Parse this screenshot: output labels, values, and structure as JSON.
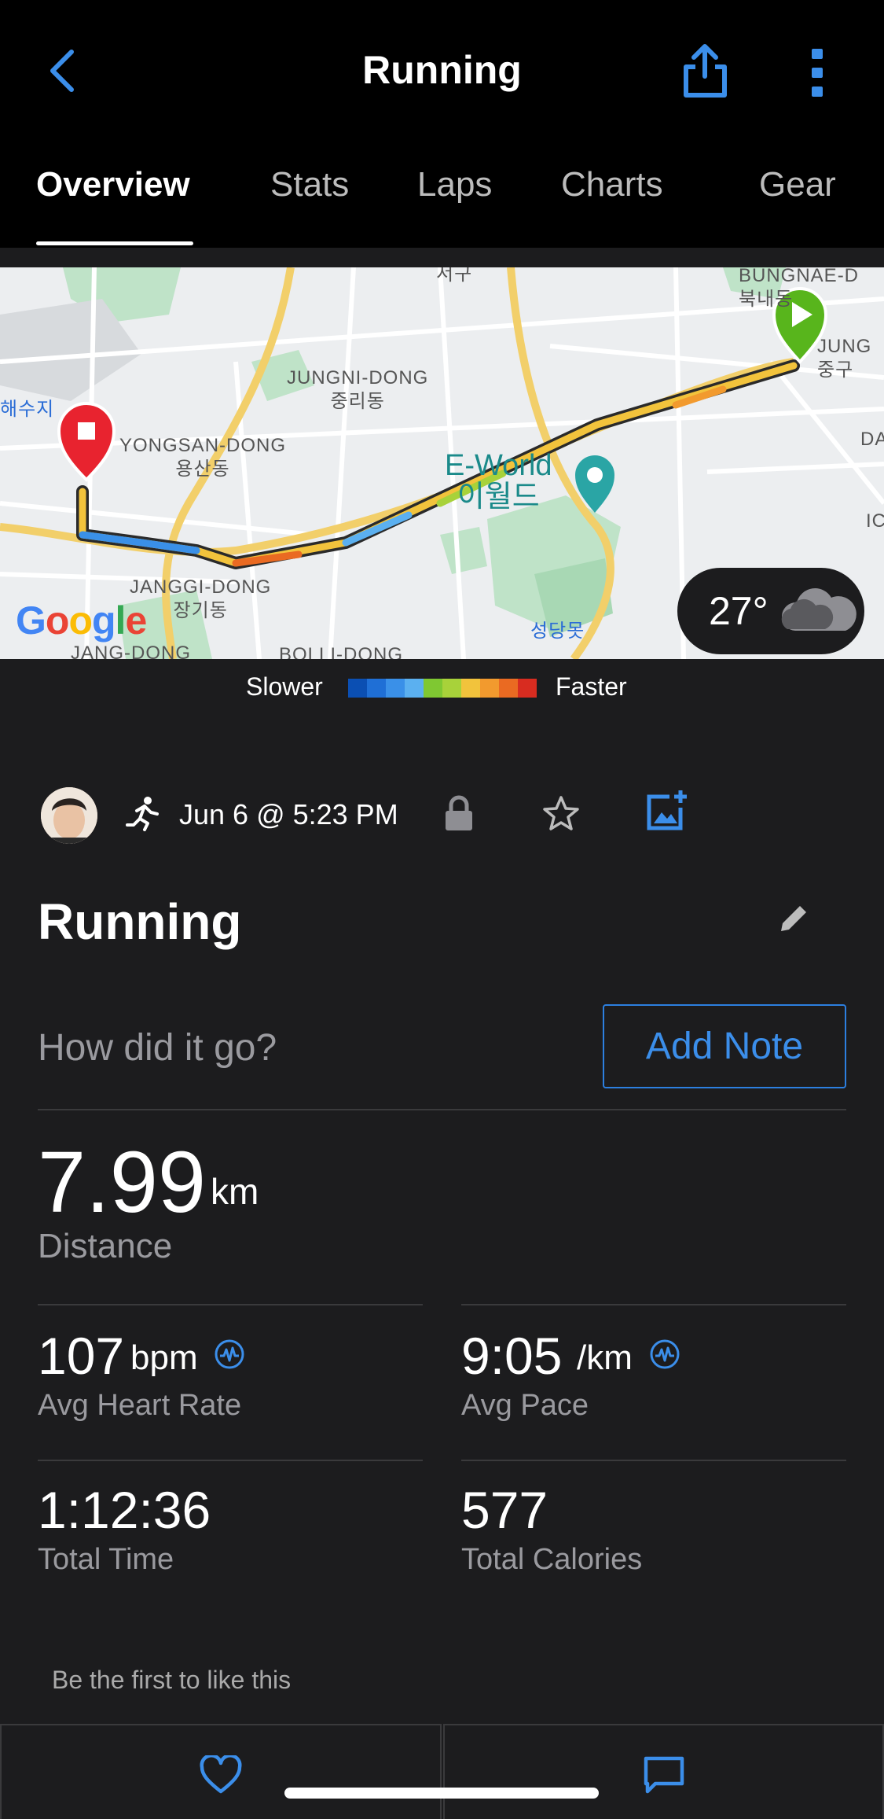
{
  "header": {
    "title": "Running",
    "back_icon": "chevron-left-icon",
    "share_icon": "share-icon",
    "more_icon": "more-vertical-icon"
  },
  "tabs": [
    {
      "label": "Overview",
      "active": true
    },
    {
      "label": "Stats",
      "active": false
    },
    {
      "label": "Laps",
      "active": false
    },
    {
      "label": "Charts",
      "active": false
    },
    {
      "label": "Gear",
      "active": false
    }
  ],
  "map": {
    "labels": {
      "seogu": "서구",
      "bungnae": "BUNGNAE-D\n북내동",
      "jung": "JUNG\n중구",
      "jungni": "JUNGNI-DONG\n중리동",
      "daesu": "해수지",
      "yongsan": "YONGSAN-DONG\n용산동",
      "eworld": "E-World\n이월드",
      "da": "DA",
      "ic": "IC",
      "janggi": "JANGGI-DONG\n장기동",
      "seongdang": "성당못",
      "jangdong": "JANG-DONG",
      "bolli": "BOLLI-DONG"
    },
    "google": "Google",
    "weather": {
      "temp": "27°",
      "icon": "cloud-icon"
    }
  },
  "legend": {
    "slower": "Slower",
    "faster": "Faster",
    "colors": [
      "#0b4fb3",
      "#1f6fd6",
      "#3a90e8",
      "#5bb0f0",
      "#7fc832",
      "#a8d23a",
      "#f2c33c",
      "#f29a2e",
      "#ea6a22",
      "#d82c20"
    ]
  },
  "activity": {
    "date": "Jun 6 @ 5:23 PM",
    "title": "Running",
    "note_prompt": "How did it go?",
    "add_note": "Add Note"
  },
  "stats": {
    "distance": {
      "value": "7.99",
      "unit": "km",
      "label": "Distance"
    },
    "heart_rate": {
      "value": "107",
      "unit": "bpm",
      "label": "Avg Heart Rate"
    },
    "pace": {
      "value": "9:05",
      "unit": "/km",
      "label": "Avg Pace"
    },
    "time": {
      "value": "1:12:36",
      "label": "Total Time"
    },
    "calories": {
      "value": "577",
      "label": "Total Calories"
    }
  },
  "social": {
    "likes_text": "Be the first to like this"
  },
  "colors": {
    "accent": "#3b8eea",
    "background": "#1c1c1e",
    "header": "#000000"
  }
}
